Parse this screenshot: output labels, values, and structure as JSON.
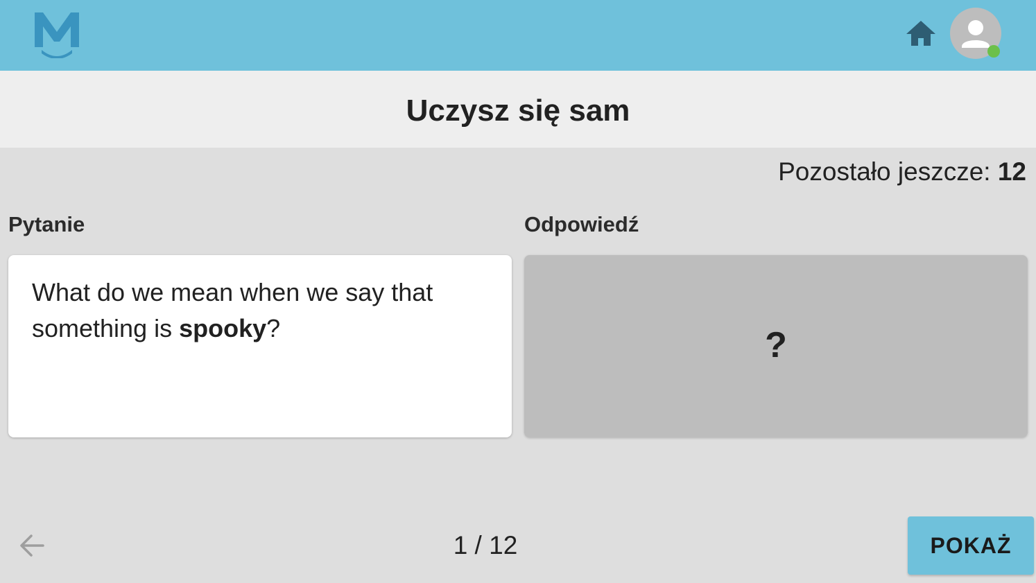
{
  "header": {
    "logo_icon": "logo-m-smile-icon",
    "home_icon": "home-icon",
    "avatar_icon": "user-avatar-icon",
    "status": "online",
    "brand_color": "#6fc1db",
    "status_color": "#6cc04a"
  },
  "page": {
    "title": "Uczysz się sam"
  },
  "progress": {
    "remaining_label": "Pozostało jeszcze:",
    "remaining_count": "12"
  },
  "question": {
    "label": "Pytanie",
    "text_before": "What do we mean when we say that something is ",
    "keyword": "spooky",
    "text_after": "?"
  },
  "answer": {
    "label": "Odpowiedź",
    "placeholder": "?"
  },
  "footer": {
    "back_icon": "arrow-left-icon",
    "pager": "1 / 12",
    "show_button_label": "POKAŻ"
  }
}
